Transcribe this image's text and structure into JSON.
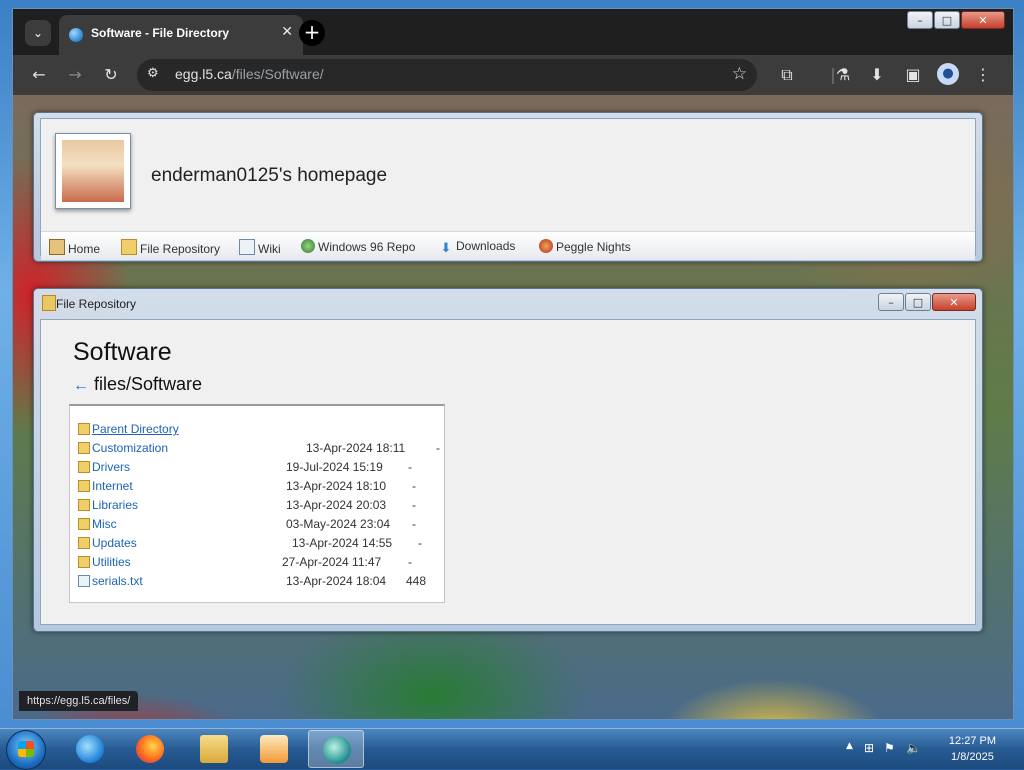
{
  "browser": {
    "tab_title": "Software - File Directory",
    "tab_close": "✕",
    "new_tab": "+",
    "url_domain": "egg.l5.ca",
    "url_path": "/files/Software/",
    "status_url": "https://egg.l5.ca/files/"
  },
  "window_controls": {
    "minimize": "–",
    "maximize": "□",
    "close": "✕"
  },
  "site": {
    "title": "enderman0125's homepage",
    "nav": [
      "Home",
      "File Repository",
      "Wiki",
      "Windows 96 Repo",
      "Downloads",
      "Peggle Nights"
    ]
  },
  "repo_window": {
    "title": "File Repository",
    "page_title": "Software",
    "breadcrumb_arrow": "←",
    "breadcrumb": "files/Software",
    "parent_label": "Parent Directory",
    "entries": [
      {
        "name": "Customization",
        "date": "13-Apr-2024 18:11",
        "size": "-",
        "type": "folder"
      },
      {
        "name": "Drivers",
        "date": "19-Jul-2024 15:19",
        "size": "-",
        "type": "folder"
      },
      {
        "name": "Internet",
        "date": "13-Apr-2024 18:10",
        "size": "-",
        "type": "folder"
      },
      {
        "name": "Libraries",
        "date": "13-Apr-2024 20:03",
        "size": "-",
        "type": "folder"
      },
      {
        "name": "Misc",
        "date": "03-May-2024 23:04",
        "size": "-",
        "type": "folder"
      },
      {
        "name": "Updates",
        "date": "13-Apr-2024 14:55",
        "size": "-",
        "type": "folder"
      },
      {
        "name": "Utilities",
        "date": "27-Apr-2024 11:47",
        "size": "-",
        "type": "folder"
      },
      {
        "name": "serials.txt",
        "date": "13-Apr-2024 18:04",
        "size": "448",
        "type": "file"
      }
    ]
  },
  "taskbar": {
    "time": "12:27 PM",
    "date": "1/8/2025"
  }
}
